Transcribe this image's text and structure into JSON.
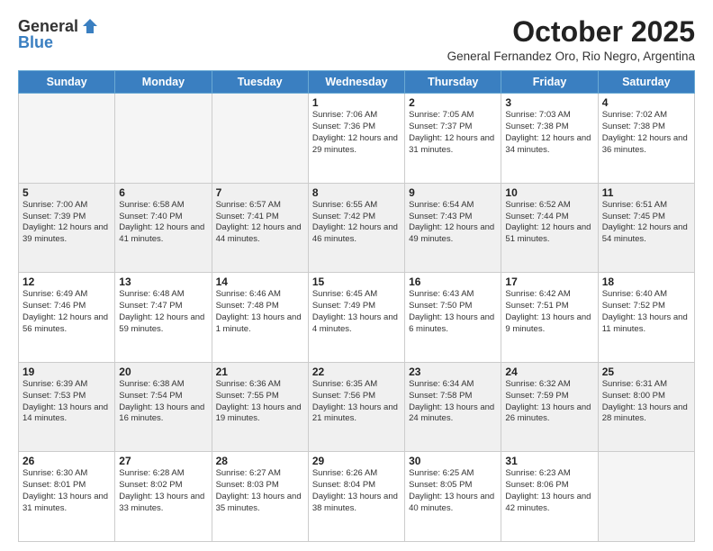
{
  "logo": {
    "general": "General",
    "blue": "Blue"
  },
  "header": {
    "month": "October 2025",
    "location": "General Fernandez Oro, Rio Negro, Argentina"
  },
  "weekdays": [
    "Sunday",
    "Monday",
    "Tuesday",
    "Wednesday",
    "Thursday",
    "Friday",
    "Saturday"
  ],
  "weeks": [
    [
      {
        "day": "",
        "info": ""
      },
      {
        "day": "",
        "info": ""
      },
      {
        "day": "",
        "info": ""
      },
      {
        "day": "1",
        "info": "Sunrise: 7:06 AM\nSunset: 7:36 PM\nDaylight: 12 hours and 29 minutes."
      },
      {
        "day": "2",
        "info": "Sunrise: 7:05 AM\nSunset: 7:37 PM\nDaylight: 12 hours and 31 minutes."
      },
      {
        "day": "3",
        "info": "Sunrise: 7:03 AM\nSunset: 7:38 PM\nDaylight: 12 hours and 34 minutes."
      },
      {
        "day": "4",
        "info": "Sunrise: 7:02 AM\nSunset: 7:38 PM\nDaylight: 12 hours and 36 minutes."
      }
    ],
    [
      {
        "day": "5",
        "info": "Sunrise: 7:00 AM\nSunset: 7:39 PM\nDaylight: 12 hours and 39 minutes."
      },
      {
        "day": "6",
        "info": "Sunrise: 6:58 AM\nSunset: 7:40 PM\nDaylight: 12 hours and 41 minutes."
      },
      {
        "day": "7",
        "info": "Sunrise: 6:57 AM\nSunset: 7:41 PM\nDaylight: 12 hours and 44 minutes."
      },
      {
        "day": "8",
        "info": "Sunrise: 6:55 AM\nSunset: 7:42 PM\nDaylight: 12 hours and 46 minutes."
      },
      {
        "day": "9",
        "info": "Sunrise: 6:54 AM\nSunset: 7:43 PM\nDaylight: 12 hours and 49 minutes."
      },
      {
        "day": "10",
        "info": "Sunrise: 6:52 AM\nSunset: 7:44 PM\nDaylight: 12 hours and 51 minutes."
      },
      {
        "day": "11",
        "info": "Sunrise: 6:51 AM\nSunset: 7:45 PM\nDaylight: 12 hours and 54 minutes."
      }
    ],
    [
      {
        "day": "12",
        "info": "Sunrise: 6:49 AM\nSunset: 7:46 PM\nDaylight: 12 hours and 56 minutes."
      },
      {
        "day": "13",
        "info": "Sunrise: 6:48 AM\nSunset: 7:47 PM\nDaylight: 12 hours and 59 minutes."
      },
      {
        "day": "14",
        "info": "Sunrise: 6:46 AM\nSunset: 7:48 PM\nDaylight: 13 hours and 1 minute."
      },
      {
        "day": "15",
        "info": "Sunrise: 6:45 AM\nSunset: 7:49 PM\nDaylight: 13 hours and 4 minutes."
      },
      {
        "day": "16",
        "info": "Sunrise: 6:43 AM\nSunset: 7:50 PM\nDaylight: 13 hours and 6 minutes."
      },
      {
        "day": "17",
        "info": "Sunrise: 6:42 AM\nSunset: 7:51 PM\nDaylight: 13 hours and 9 minutes."
      },
      {
        "day": "18",
        "info": "Sunrise: 6:40 AM\nSunset: 7:52 PM\nDaylight: 13 hours and 11 minutes."
      }
    ],
    [
      {
        "day": "19",
        "info": "Sunrise: 6:39 AM\nSunset: 7:53 PM\nDaylight: 13 hours and 14 minutes."
      },
      {
        "day": "20",
        "info": "Sunrise: 6:38 AM\nSunset: 7:54 PM\nDaylight: 13 hours and 16 minutes."
      },
      {
        "day": "21",
        "info": "Sunrise: 6:36 AM\nSunset: 7:55 PM\nDaylight: 13 hours and 19 minutes."
      },
      {
        "day": "22",
        "info": "Sunrise: 6:35 AM\nSunset: 7:56 PM\nDaylight: 13 hours and 21 minutes."
      },
      {
        "day": "23",
        "info": "Sunrise: 6:34 AM\nSunset: 7:58 PM\nDaylight: 13 hours and 24 minutes."
      },
      {
        "day": "24",
        "info": "Sunrise: 6:32 AM\nSunset: 7:59 PM\nDaylight: 13 hours and 26 minutes."
      },
      {
        "day": "25",
        "info": "Sunrise: 6:31 AM\nSunset: 8:00 PM\nDaylight: 13 hours and 28 minutes."
      }
    ],
    [
      {
        "day": "26",
        "info": "Sunrise: 6:30 AM\nSunset: 8:01 PM\nDaylight: 13 hours and 31 minutes."
      },
      {
        "day": "27",
        "info": "Sunrise: 6:28 AM\nSunset: 8:02 PM\nDaylight: 13 hours and 33 minutes."
      },
      {
        "day": "28",
        "info": "Sunrise: 6:27 AM\nSunset: 8:03 PM\nDaylight: 13 hours and 35 minutes."
      },
      {
        "day": "29",
        "info": "Sunrise: 6:26 AM\nSunset: 8:04 PM\nDaylight: 13 hours and 38 minutes."
      },
      {
        "day": "30",
        "info": "Sunrise: 6:25 AM\nSunset: 8:05 PM\nDaylight: 13 hours and 40 minutes."
      },
      {
        "day": "31",
        "info": "Sunrise: 6:23 AM\nSunset: 8:06 PM\nDaylight: 13 hours and 42 minutes."
      },
      {
        "day": "",
        "info": ""
      }
    ]
  ]
}
